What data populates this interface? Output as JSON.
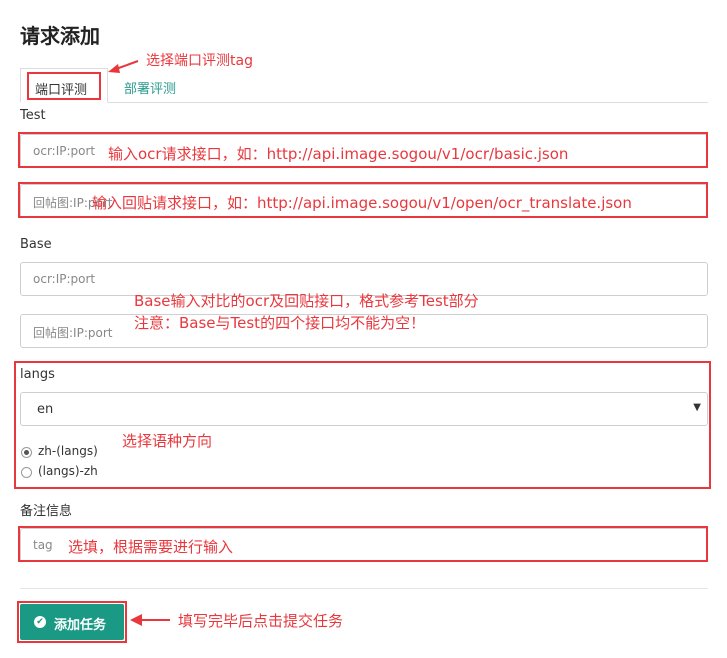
{
  "page": {
    "title": "请求添加"
  },
  "tabs": [
    {
      "label": "端口评测"
    },
    {
      "label": "部署评测"
    }
  ],
  "test": {
    "section_label": "Test",
    "ocr_placeholder": "ocr:IP:port",
    "paste_placeholder": "回帖图:IP:port"
  },
  "base": {
    "section_label": "Base",
    "ocr_placeholder": "ocr:IP:port",
    "paste_placeholder": "回帖图:IP:port"
  },
  "langs": {
    "section_label": "langs",
    "selected": "en",
    "directions": [
      {
        "label": "zh-(langs)",
        "checked": true
      },
      {
        "label": "(langs)-zh",
        "checked": false
      }
    ]
  },
  "remark": {
    "section_label": "备注信息",
    "placeholder": "tag"
  },
  "submit_label": "添加任务",
  "annotations": {
    "tab_hint": "选择端口评测tag",
    "test_ocr_hint": "输入ocr请求接口，如：http://api.image.sogou/v1/ocr/basic.json",
    "test_paste_hint": "输入回贴请求接口，如：http://api.image.sogou/v1/open/ocr_translate.json",
    "base_hint_line1": "Base输入对比的ocr及回贴接口，格式参考Test部分",
    "base_hint_line2": "注意：Base与Test的四个接口均不能为空！",
    "langs_hint": "选择语种方向",
    "remark_hint": "选填，根据需要进行输入",
    "submit_hint": "填写完毕后点击提交任务"
  },
  "colors": {
    "annotation_red": "#e8383d",
    "accent_green": "#1a9a85"
  }
}
